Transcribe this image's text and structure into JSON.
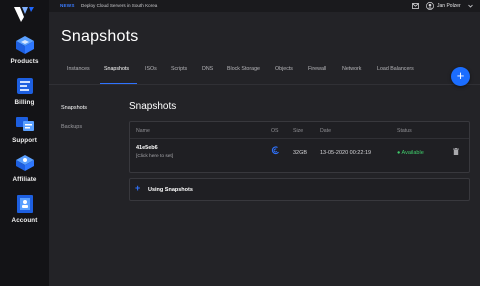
{
  "sidebar": {
    "logo": "vultr-logo-icon",
    "items": [
      {
        "label": "Products",
        "icon": "layers-cube-icon"
      },
      {
        "label": "Billing",
        "icon": "billing-icon"
      },
      {
        "label": "Support",
        "icon": "support-icon"
      },
      {
        "label": "Affiliate",
        "icon": "affiliate-icon"
      },
      {
        "label": "Account",
        "icon": "account-icon"
      }
    ]
  },
  "topbar": {
    "news_tag": "NEWS",
    "news_text": "Deploy Cloud Servers in South Korea",
    "user_name": "Jan Polzer"
  },
  "page": {
    "title": "Snapshots"
  },
  "tabs": [
    {
      "label": "Instances",
      "active": false
    },
    {
      "label": "Snapshots",
      "active": true
    },
    {
      "label": "ISOs",
      "active": false
    },
    {
      "label": "Scripts",
      "active": false
    },
    {
      "label": "DNS",
      "active": false
    },
    {
      "label": "Block Storage",
      "active": false
    },
    {
      "label": "Objects",
      "active": false
    },
    {
      "label": "Firewall",
      "active": false
    },
    {
      "label": "Network",
      "active": false
    },
    {
      "label": "Load Balancers",
      "active": false
    }
  ],
  "fab": {
    "label": "+"
  },
  "subnav": [
    {
      "label": "Snapshots",
      "active": true
    },
    {
      "label": "Backups",
      "active": false
    }
  ],
  "section": {
    "title": "Snapshots"
  },
  "table": {
    "columns": [
      "Name",
      "OS",
      "Size",
      "Date",
      "Status"
    ],
    "rows": [
      {
        "name": "41e5eb6",
        "hint": "[Click here to set]",
        "os_icon": "debian-icon",
        "size": "32GB",
        "date": "13-05-2020 00:22:19",
        "status": "Available"
      }
    ]
  },
  "using": {
    "plus": "+",
    "label": "Using Snapshots"
  },
  "colors": {
    "accent": "#2f73ff",
    "fab": "#1b6dff",
    "status_ok": "#3fce6b",
    "sidebar_bg": "#131316",
    "page_bg": "#232327"
  }
}
